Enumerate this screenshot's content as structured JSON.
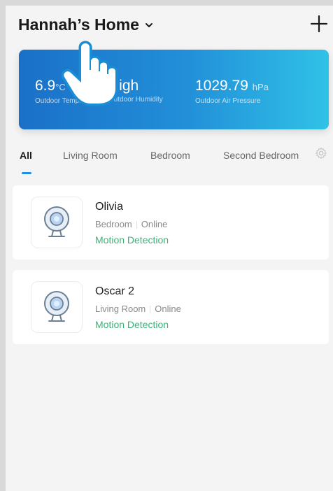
{
  "header": {
    "home_name": "Hannah’s Home",
    "add_icon": "plus-icon",
    "chevron_icon": "chevron-down-icon"
  },
  "weather": {
    "temperature": {
      "value": "6.9",
      "unit": "°C",
      "label": "Outdoor Temp."
    },
    "humidity": {
      "value": "High",
      "label": "Outdoor Humidity"
    },
    "pressure": {
      "value": "1029.79",
      "unit": "hPa",
      "label": "Outdoor Air Pressure"
    },
    "gradient_colors": [
      "#1a70c8",
      "#30c2e6"
    ]
  },
  "tabs": {
    "items": [
      "All",
      "Living Room",
      "Bedroom",
      "Second Bedroom"
    ],
    "active": "All",
    "settings_icon": "gear-icon",
    "accent": "#1f8ee6"
  },
  "devices": [
    {
      "name": "Olivia",
      "room": "Bedroom",
      "status": "Online",
      "event": "Motion Detection",
      "icon": "camera-icon"
    },
    {
      "name": "Oscar 2",
      "room": "Living Room",
      "status": "Online",
      "event": "Motion Detection",
      "icon": "camera-icon"
    }
  ],
  "colors": {
    "motion_green": "#3bb378"
  },
  "overlay": {
    "icon": "tap-hand-icon"
  }
}
